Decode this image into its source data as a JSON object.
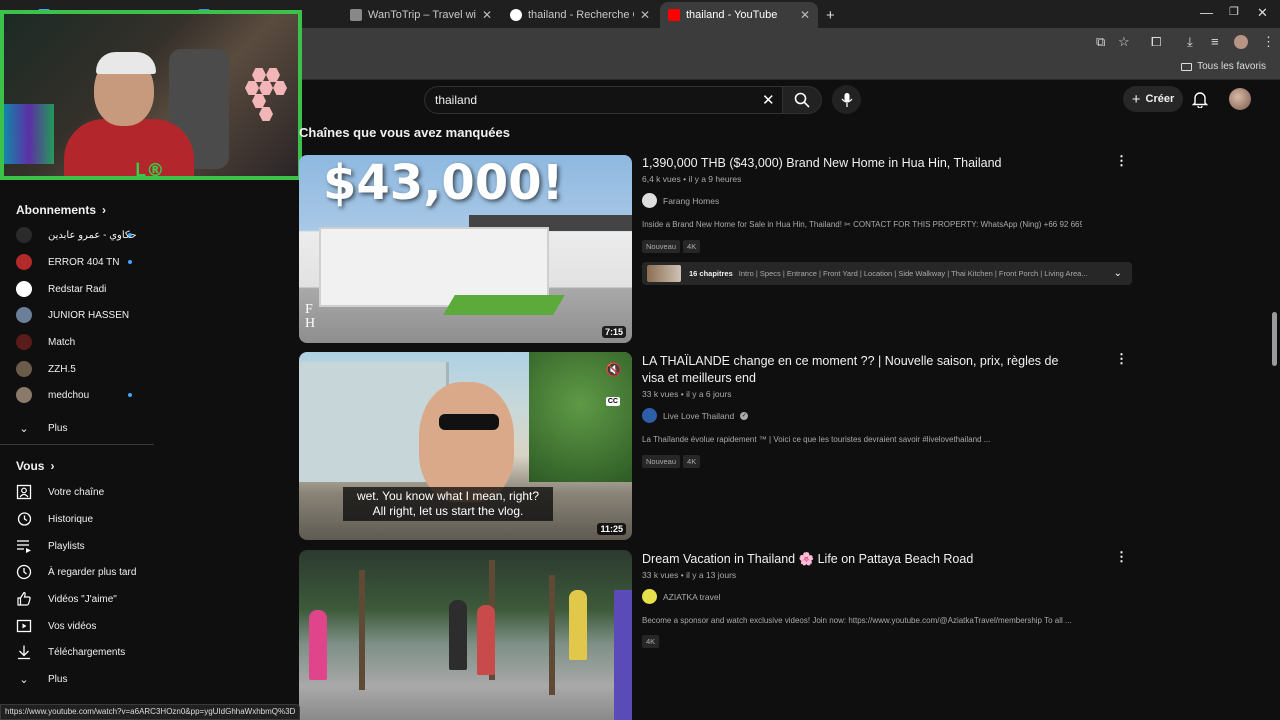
{
  "browser": {
    "tabs": [
      {
        "title": "",
        "favicon_color": "#3ea6ff"
      },
      {
        "title": "",
        "favicon_color": "#4285f4"
      },
      {
        "title": "WanToTrip – Travel with Your Fa",
        "favicon_color": "#888888"
      },
      {
        "title": "thailand - Recherche Google",
        "favicon_color": "#ffffff"
      },
      {
        "title": "thailand - YouTube",
        "favicon_color": "#ff0000"
      }
    ],
    "new_tab": "+",
    "bookmarks_all": "Tous les favoris",
    "status_url": "https://www.youtube.com/watch?v=a6ARC3HOzn0&pp=ygUIdGhhaWxhbmQ%3D"
  },
  "header": {
    "search_value": "thailand",
    "create_label": "Créer"
  },
  "sidebar": {
    "subscriptions_title": "Abonnements",
    "subscriptions": [
      {
        "label": "حكاوي - عمرو عابدين",
        "color": "#2b2b2b",
        "new": true
      },
      {
        "label": "ERROR 404 TN",
        "color": "#b22a2a",
        "new": true
      },
      {
        "label": "Redstar Radi",
        "color": "#ffffff",
        "new": false
      },
      {
        "label": "JUNIOR HASSEN",
        "color": "#6c7f99",
        "new": false
      },
      {
        "label": "Match",
        "color": "#5a1b1b",
        "new": false
      },
      {
        "label": "ZZH.5",
        "color": "#6b5b4b",
        "new": false
      },
      {
        "label": "medchou",
        "color": "#8a7a6a",
        "new": true
      }
    ],
    "subs_more": "Plus",
    "you_title": "Vous",
    "you_items": [
      {
        "label": "Votre chaîne",
        "icon": "channel-icon"
      },
      {
        "label": "Historique",
        "icon": "history-icon"
      },
      {
        "label": "Playlists",
        "icon": "playlists-icon"
      },
      {
        "label": "À regarder plus tard",
        "icon": "watch-later-icon"
      },
      {
        "label": "Vidéos \"J'aime\"",
        "icon": "like-icon"
      },
      {
        "label": "Vos vidéos",
        "icon": "your-videos-icon"
      },
      {
        "label": "Téléchargements",
        "icon": "download-icon"
      }
    ],
    "you_more": "Plus"
  },
  "main": {
    "section_title": "Chaînes que vous avez manquées",
    "videos": [
      {
        "title": "1,390,000 THB ($43,000) Brand New Home in Hua Hin, Thailand",
        "views": "6,4 k vues",
        "age": "il y a 9 heures",
        "channel": "Farang Homes",
        "channel_color": "#dddddd",
        "description": "Inside a Brand New Home for Sale in Hua Hin, Thailand! ✂ CONTACT FOR THIS PROPERTY: WhatsApp (Ning) +66 92 669 ...",
        "badges": [
          "Nouveau",
          "4K"
        ],
        "duration": "7:15",
        "thumb_text": "$43,000!",
        "thumb_watermark": "F H",
        "chapters_count": "16 chapitres",
        "chapters_list": "Intro | Specs | Entrance | Front Yard | Location | Side Walkway | Thai Kitchen | Front Porch | Living Area..."
      },
      {
        "title": "LA THAÏLANDE change en ce moment ?? | Nouvelle saison, prix, règles de visa et meilleurs end",
        "views": "33 k vues",
        "age": "il y a 6 jours",
        "channel": "Live Love Thailand",
        "channel_color": "#2e5ea8",
        "description": "La Thaïlande évolue rapidement ™ | Voici ce que les touristes devraient savoir #livelovethailand ...",
        "badges": [
          "Nouveau",
          "4K"
        ],
        "duration": "11:25",
        "subtitle_line1": "wet. You know what I mean, right?",
        "subtitle_line2": "All right, let us start the vlog.",
        "cc": "CC"
      },
      {
        "title": "Dream Vacation in Thailand 🌸 Life on Pattaya Beach Road",
        "views": "33 k vues",
        "age": "il y a 13 jours",
        "channel": "AZIATKA travel",
        "channel_color": "#e6e04a",
        "description": "Become a sponsor and watch exclusive videos! Join now: https://www.youtube.com/@AziatkaTravel/membership To all ...",
        "badges": [
          "4K"
        ]
      }
    ]
  }
}
